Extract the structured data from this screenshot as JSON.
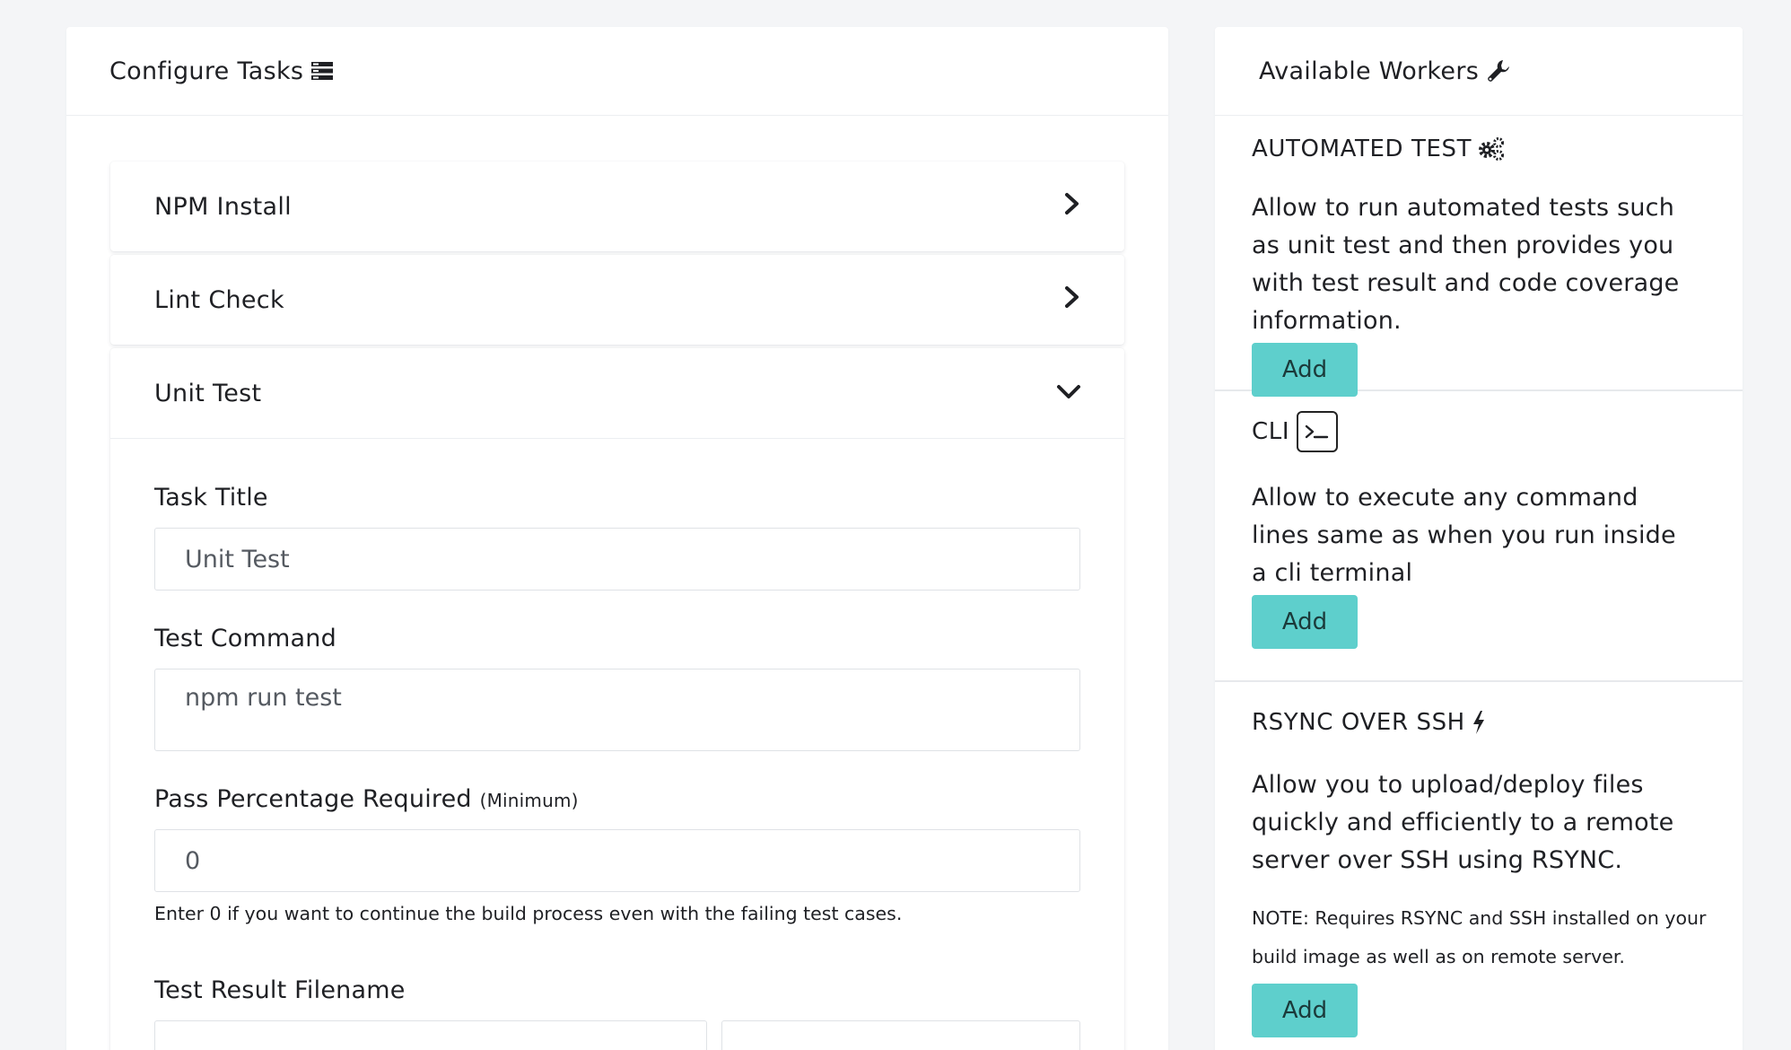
{
  "configure": {
    "title": "Configure Tasks",
    "icon": "server-stack-icon",
    "tasks": [
      {
        "label": "NPM Install",
        "state": "collapsed",
        "icon": "chevron-right-icon"
      },
      {
        "label": "Lint Check",
        "state": "collapsed",
        "icon": "chevron-right-icon"
      },
      {
        "label": "Unit Test",
        "state": "expanded",
        "icon": "chevron-down-icon"
      }
    ],
    "form": {
      "task_title_label": "Task Title",
      "task_title_value": "Unit Test",
      "test_command_label": "Test Command",
      "test_command_value": "npm run test",
      "pass_pct_label": "Pass Percentage Required",
      "pass_pct_sublabel": "(Minimum)",
      "pass_pct_value": "0",
      "pass_pct_help": "Enter 0 if you want to continue the build process even with the failing test cases.",
      "result_filename_label": "Test Result Filename"
    }
  },
  "workers": {
    "title": "Available Workers",
    "icon": "wrench-icon",
    "items": [
      {
        "title": "AUTOMATED TEST",
        "icon": "gears-icon",
        "description": "Allow to run automated tests such as unit test and then provides you with test result and code coverage information.",
        "button": "Add"
      },
      {
        "title": "CLI",
        "icon": "terminal-icon",
        "description": "Allow to execute any command lines same as when you run inside a cli terminal",
        "button": "Add"
      },
      {
        "title": "RSYNC OVER SSH",
        "icon": "bolt-icon",
        "description": "Allow you to upload/deploy files quickly and efficiently to a remote server over SSH using RSYNC.",
        "note": "NOTE: Requires RSYNC and SSH installed on your build image as well as on remote server.",
        "button": "Add"
      }
    ]
  },
  "colors": {
    "accent": "#5ecfcc",
    "background": "#f4f5f7",
    "card": "#ffffff"
  }
}
